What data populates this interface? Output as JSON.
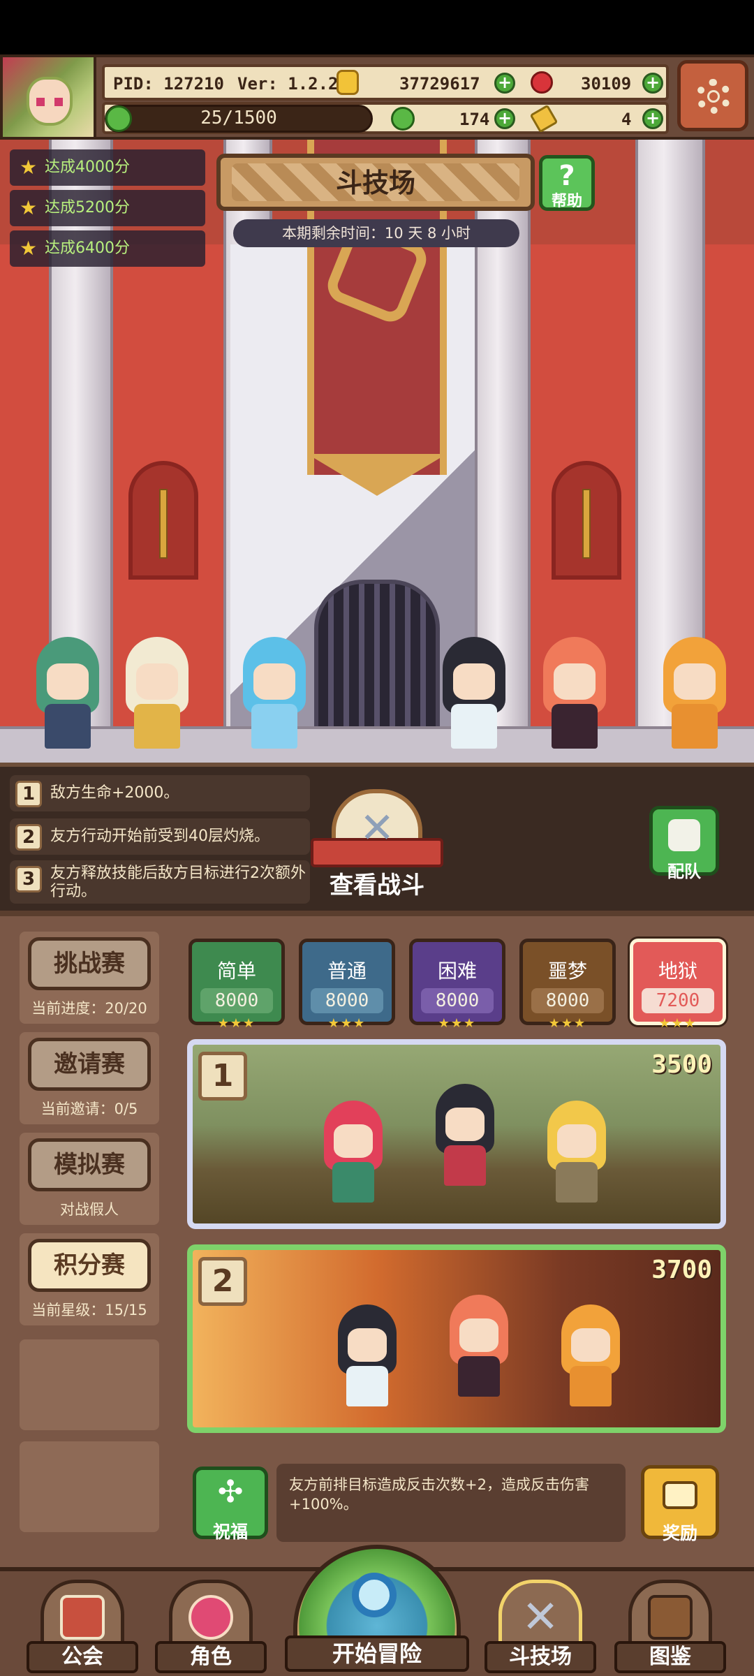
{
  "status": {
    "pid": "PID: 127210",
    "version": "Ver: 1.2.2.5",
    "gold": "37729617",
    "gems": "30109",
    "stamina": "25/1500",
    "clover": "174",
    "tokens": "4"
  },
  "goals": [
    "达成4000分",
    "达成5200分",
    "达成6400分"
  ],
  "arena": {
    "title": "斗技场",
    "help_label": "帮助",
    "time_remaining": "本期剩余时间：10 天 8 小时"
  },
  "modifiers": [
    {
      "num": "1",
      "text": "敌方生命+2000。"
    },
    {
      "num": "2",
      "text": "友方行动开始前受到40层灼烧。"
    },
    {
      "num": "3",
      "text": "友方释放技能后敌方目标进行2次额外行动。"
    }
  ],
  "view_battle_label": "查看战斗",
  "team_label": "配队",
  "modes": [
    {
      "label": "挑战赛",
      "sub": "当前进度：20/20"
    },
    {
      "label": "邀请赛",
      "sub": "当前邀请：0/5"
    },
    {
      "label": "模拟赛",
      "sub": "对战假人"
    },
    {
      "label": "积分赛",
      "sub": "当前星级：15/15"
    }
  ],
  "difficulties": [
    {
      "name": "简单",
      "score": "8000",
      "stars": "★★★",
      "color": "#3e8a4f",
      "inner": "#5fa36a"
    },
    {
      "name": "普通",
      "score": "8000",
      "stars": "★★★",
      "color": "#3e6a8a",
      "inner": "#5f8eaa"
    },
    {
      "name": "困难",
      "score": "8000",
      "stars": "★★★",
      "color": "#5a3e8a",
      "inner": "#7a5eaa"
    },
    {
      "name": "噩梦",
      "score": "8000",
      "stars": "★★★",
      "color": "#7a5028",
      "inner": "#9a7048"
    },
    {
      "name": "地狱",
      "score": "7200",
      "stars": "★★★",
      "color": "#e25a58",
      "inner": "#f6dcd2"
    }
  ],
  "opponents": [
    {
      "num": "1",
      "score": "3500"
    },
    {
      "num": "2",
      "score": "3700"
    }
  ],
  "blessing": {
    "label": "祝福",
    "text": "友方前排目标造成反击次数+2，造成反击伤害+100%。"
  },
  "reward_label": "奖励",
  "nav": {
    "guild": "公会",
    "character": "角色",
    "adventure": "开始冒险",
    "arena": "斗技场",
    "codex": "图鉴"
  },
  "icons": {
    "settings": "gear-icon",
    "gold": "coin-icon",
    "gems": "ruby-icon",
    "stamina": "leaf-icon",
    "clover": "clover-icon",
    "tokens": "pointer-icon",
    "help": "question-icon",
    "goal": "star-icon"
  }
}
